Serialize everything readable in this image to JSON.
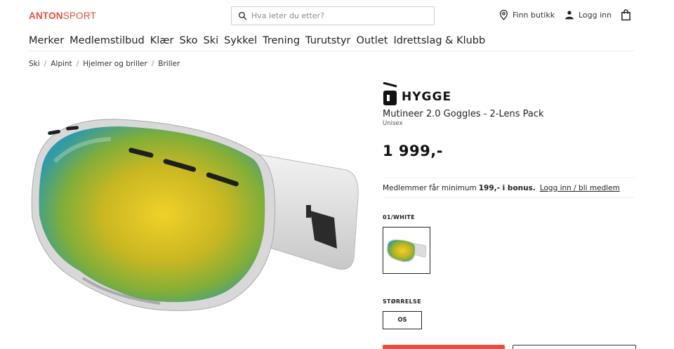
{
  "header": {
    "logo_primary": "ANTON",
    "logo_secondary": "SPORT",
    "search_placeholder": "Hva leter du etter?",
    "store_label": "Finn butikk",
    "login_label": "Logg inn",
    "icons": [
      "search-icon",
      "location-pin-icon",
      "user-icon",
      "bag-icon"
    ]
  },
  "nav": {
    "items": [
      "Merker",
      "Medlemstilbud",
      "Klær",
      "Sko",
      "Ski",
      "Sykkel",
      "Trening",
      "Turutstyr",
      "Outlet",
      "Idrettslag & Klubb"
    ]
  },
  "breadcrumb": {
    "items": [
      "Ski",
      "Alpint",
      "Hjelmer og briller",
      "Briller"
    ],
    "separator": "/"
  },
  "product": {
    "brand": "HYGGE",
    "title": "Mutineer 2.0 Goggles - 2-Lens Pack",
    "gender": "Unisex",
    "price": "1 999,-",
    "member_prefix": "Medlemmer får minimum",
    "member_bonus": "199,- i bonus.",
    "member_link": "Logg inn / bli medlem",
    "color_label": "01/WHITE",
    "size_label": "STØRRELSE",
    "size_value": "OS"
  },
  "colors": {
    "accent": "#e64d3a",
    "text": "#222222",
    "border": "#cfcfcf"
  }
}
